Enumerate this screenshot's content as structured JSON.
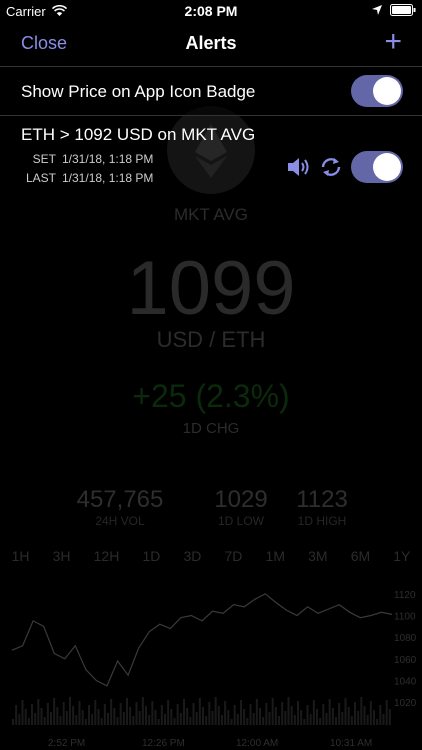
{
  "status_bar": {
    "carrier": "Carrier",
    "time": "2:08 PM"
  },
  "nav": {
    "close_label": "Close",
    "title": "Alerts",
    "add_label": "+"
  },
  "badge_row": {
    "label": "Show Price on App Icon Badge",
    "enabled": true
  },
  "alert": {
    "condition": "ETH > 1092 USD on MKT AVG",
    "set_label": "SET",
    "set_value": "1/31/18, 1:18 PM",
    "last_label": "LAST",
    "last_value": "1/31/18, 1:18 PM",
    "enabled": true
  },
  "ticker": {
    "source": "MKT AVG",
    "price": "1099",
    "unit": "USD / ETH",
    "change": "+25  (2.3%)",
    "change_label": "1D CHG",
    "stats": [
      {
        "value": "457,765",
        "label": "24H VOL"
      },
      {
        "value": "1029",
        "label": "1D LOW"
      },
      {
        "value": "1123",
        "label": "1D HIGH"
      }
    ],
    "ranges": [
      "1H",
      "3H",
      "12H",
      "1D",
      "3D",
      "7D",
      "1M",
      "3M",
      "6M",
      "1Y"
    ]
  },
  "chart_data": {
    "type": "line",
    "y_ticks": [
      "1120",
      "1100",
      "1080",
      "1060",
      "1040",
      "1020"
    ],
    "x_ticks": [
      "2:52 PM",
      "12:26 PM",
      "12:00 AM",
      "10:31 AM"
    ],
    "values": [
      1068,
      1072,
      1095,
      1090,
      1065,
      1060,
      1072,
      1050,
      1040,
      1035,
      1058,
      1045,
      1070,
      1085,
      1092,
      1088,
      1098,
      1100,
      1095,
      1104,
      1102,
      1110,
      1108,
      1115,
      1120,
      1112,
      1105,
      1100,
      1108,
      1102,
      1106,
      1110,
      1103,
      1098,
      1100,
      1103,
      1101
    ]
  },
  "colors": {
    "accent": "#8a8ee6",
    "toggle_on": "#6367a8",
    "background": "#000000"
  }
}
